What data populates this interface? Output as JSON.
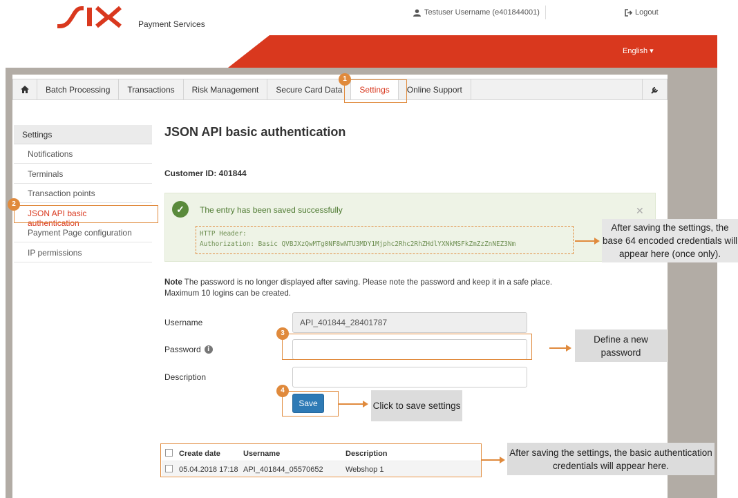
{
  "header": {
    "brand_name": "SIX",
    "brand_sub": "Payment Services",
    "user": "Testuser Username (e401844001)",
    "logout": "Logout",
    "language": "English"
  },
  "nav": {
    "tabs": [
      "Batch Processing",
      "Transactions",
      "Risk Management",
      "Secure Card Data",
      "Settings",
      "Online Support"
    ],
    "active_tab": "Settings"
  },
  "sidebar": {
    "title": "Settings",
    "items": [
      "Notifications",
      "Terminals",
      "Transaction points",
      "JSON API basic authentication",
      "Payment Page configuration",
      "IP permissions"
    ],
    "active": "JSON API basic authentication"
  },
  "main": {
    "title": "JSON API basic authentication",
    "customer_id": "Customer ID: 401844",
    "alert_message": "The entry has been saved successfully",
    "http_header_label": "HTTP Header:",
    "http_header_value": "Authorization: Basic QVBJXzQwMTg0NF8wNTU3MDY1Mjphc2Rhc2RhZHdlYXNkMSFkZmZzZnNEZ3Nm",
    "note_label": "Note",
    "note_text": " The password is no longer displayed after saving. Please note the password and keep it in a safe place.",
    "note_text2": "Maximum 10 logins can be created.",
    "username_label": "Username",
    "username_value": "API_401844_28401787",
    "password_label": "Password",
    "password_value": "",
    "description_label": "Description",
    "description_value": "",
    "save_label": "Save"
  },
  "table": {
    "columns": [
      "Create date",
      "Username",
      "Description"
    ],
    "rows": [
      [
        "05.04.2018 17:18",
        "API_401844_05570652",
        "Webshop 1"
      ]
    ]
  },
  "annotations": {
    "badges": [
      "1",
      "2",
      "3",
      "4"
    ],
    "callout_header": "After saving the settings, the base 64 encoded credentials will appear here (once only).",
    "callout_password": "Define a new password",
    "callout_save": "Click to save settings",
    "callout_table": "After saving the settings, the basic authentication credentials will appear here."
  },
  "colors": {
    "brand_red": "#d9381e",
    "annotation_orange": "#e08a3c",
    "button_blue": "#2e7ab5",
    "success_green": "#5a8a3c"
  }
}
